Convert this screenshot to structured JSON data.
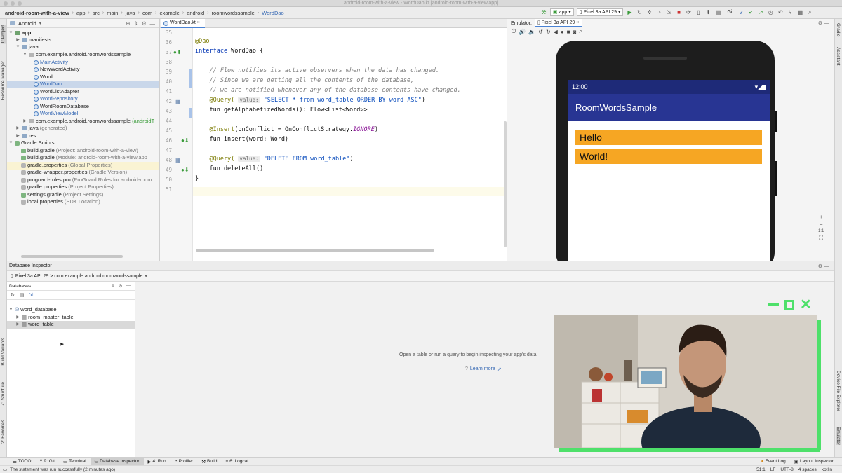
{
  "window": {
    "title": "android-room-with-a-view - WordDao.kt [android-room-with-a-view.app]"
  },
  "breadcrumbs": [
    "android-room-with-a-view",
    "app",
    "src",
    "main",
    "java",
    "com",
    "example",
    "android",
    "roomwordssample",
    "WordDao"
  ],
  "toolbar": {
    "run_config": "app",
    "device": "Pixel 3a API 29",
    "git_label": "Git:"
  },
  "project_panel": {
    "view_mode": "Android",
    "items": [
      {
        "label": "app",
        "bold": true
      },
      {
        "label": "manifests"
      },
      {
        "label": "java"
      },
      {
        "label": "com.example.android.roomwordssample"
      },
      {
        "label": "MainActivity"
      },
      {
        "label": "NewWordActivity"
      },
      {
        "label": "Word"
      },
      {
        "label": "WordDao"
      },
      {
        "label": "WordListAdapter"
      },
      {
        "label": "WordRepository"
      },
      {
        "label": "WordRoomDatabase"
      },
      {
        "label": "WordViewModel"
      },
      {
        "label": "com.example.android.roomwordssample",
        "suffix": "(androidT"
      },
      {
        "label": "java",
        "suffix": "(generated)"
      },
      {
        "label": "res"
      },
      {
        "label": "Gradle Scripts"
      },
      {
        "label": "build.gradle",
        "suffix": "(Project: android-room-with-a-view)"
      },
      {
        "label": "build.gradle",
        "suffix": "(Module: android-room-with-a-view.app"
      },
      {
        "label": "gradle.properties",
        "suffix": "(Global Properties)"
      },
      {
        "label": "gradle-wrapper.properties",
        "suffix": "(Gradle Version)"
      },
      {
        "label": "proguard-rules.pro",
        "suffix": "(ProGuard Rules for android-room"
      },
      {
        "label": "gradle.properties",
        "suffix": "(Project Properties)"
      },
      {
        "label": "settings.gradle",
        "suffix": "(Project Settings)"
      },
      {
        "label": "local.properties",
        "suffix": "(SDK Location)"
      }
    ]
  },
  "editor": {
    "tab": "WordDao.kt",
    "line_numbers": [
      "35",
      "36",
      "37",
      "38",
      "39",
      "40",
      "41",
      "42",
      "43",
      "44",
      "45",
      "46",
      "47",
      "48",
      "49",
      "50",
      "51"
    ],
    "lines": {
      "l36": "@Dao",
      "l37_kw": "interface",
      "l37_rest": " WordDao {",
      "l39": "    // Flow notifies its active observers when the data has changed.",
      "l40": "    // Since we are getting all the contents of the database,",
      "l41": "    // we are notified whenever any of the database contents have changed.",
      "l42_an": "    @Query(",
      "l42_hint": "value:",
      "l42_str": "\"SELECT * from word_table ORDER BY word ASC\"",
      "l42_end": ")",
      "l43": "    fun getAlphabetizedWords(): Flow<List<Word>>",
      "l45_an": "    @Insert",
      "l45_a": "(onConflict = OnConflictStrategy.",
      "l45_b": "IGNORE",
      "l45_c": ")",
      "l46": "    fun insert(word: Word)",
      "l48_an": "    @Query(",
      "l48_hint": "value:",
      "l48_str": "\"DELETE FROM word_table\"",
      "l48_end": ")",
      "l49": "    fun deleteAll()",
      "l50": "}"
    }
  },
  "emulator": {
    "label": "Emulator:",
    "device_tab": "Pixel 3a API 29",
    "status_time": "12:00",
    "app_title": "RoomWordsSample",
    "words": [
      "Hello",
      "World!"
    ]
  },
  "db_inspector": {
    "title": "Database Inspector",
    "device_path": "Pixel 3a API 29 > com.example.android.roomwordssample",
    "databases_label": "Databases",
    "tree": [
      {
        "label": "word_database"
      },
      {
        "label": "room_master_table"
      },
      {
        "label": "word_table"
      }
    ],
    "empty_message": "Open a table or run a query to begin inspecting your app's data",
    "learn_more": "Learn more"
  },
  "left_strip": [
    "1: Project",
    "Resource Manager",
    "Build Variants",
    "Z: Structure",
    "2: Favorites"
  ],
  "right_strip": [
    "Gradle",
    "Assistant",
    "Device File Explorer",
    "Emulator"
  ],
  "tool_windows": [
    "TODO",
    "9: Git",
    "Terminal",
    "Database Inspector",
    "4: Run",
    "Profiler",
    "Build",
    "6: Logcat",
    "Event Log",
    "Layout Inspector"
  ],
  "status": {
    "message": "The statement was run successfully (2 minutes ago)",
    "position": "51:1",
    "line_sep": "LF",
    "encoding": "UTF-8",
    "indent": "4 spaces",
    "language": "kotlin"
  },
  "colors": {
    "accent": "#4a83d4",
    "app_bar": "#283593",
    "word_bg": "#f6a623",
    "pip_frame": "#4ee06a"
  }
}
